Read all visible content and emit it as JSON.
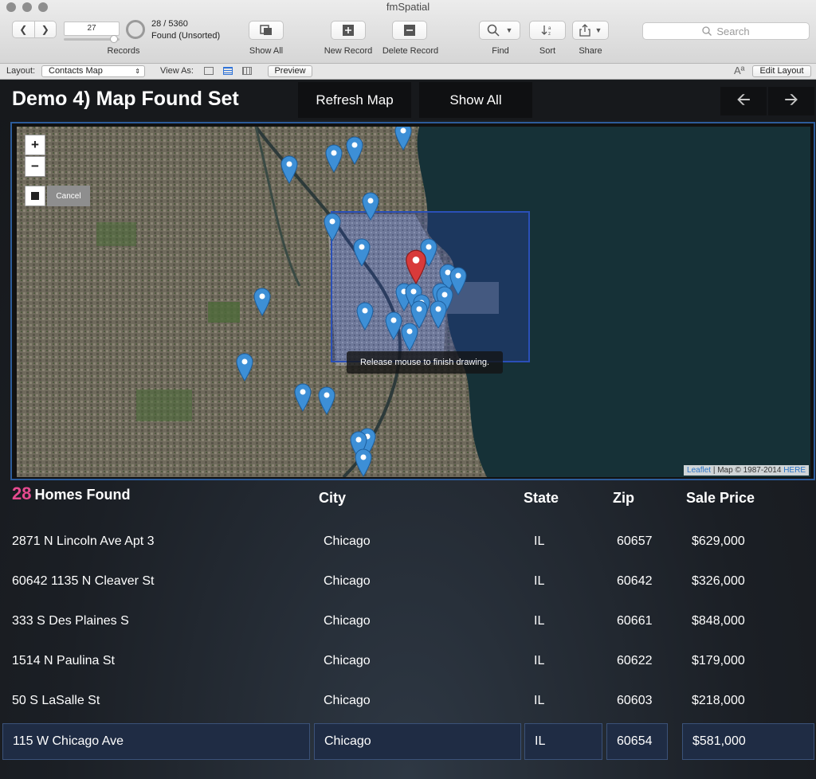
{
  "window": {
    "title": "fmSpatial"
  },
  "toolbar": {
    "record_number": "27",
    "records_label": "Records",
    "found_count": "28 / 5360",
    "found_state": "Found (Unsorted)",
    "show_all": "Show All",
    "new_record": "New Record",
    "delete_record": "Delete Record",
    "find": "Find",
    "sort": "Sort",
    "share": "Share",
    "search_placeholder": "Search"
  },
  "layout_bar": {
    "layout_label": "Layout:",
    "layout_value": "Contacts Map",
    "view_as_label": "View As:",
    "preview": "Preview",
    "edit_layout": "Edit Layout"
  },
  "header": {
    "title": "Demo 4) Map Found Set",
    "refresh_map": "Refresh Map",
    "show_all": "Show All"
  },
  "map": {
    "zoom_in": "+",
    "zoom_out": "−",
    "cancel": "Cancel",
    "tooltip": "Release mouse to finish drawing.",
    "attribution_link": "Leaflet",
    "attribution_sep": " | Map © 1987-2014 ",
    "attribution_here": "HERE"
  },
  "results": {
    "count": "28",
    "count_label": "Homes Found",
    "columns": {
      "city": "City",
      "state": "State",
      "zip": "Zip",
      "price": "Sale Price"
    },
    "rows": [
      {
        "address": "2871 N Lincoln Ave Apt 3",
        "city": "Chicago",
        "state": "IL",
        "zip": "60657",
        "price": "$629,000"
      },
      {
        "address": "60642 1135 N Cleaver St",
        "city": "Chicago",
        "state": "IL",
        "zip": "60642",
        "price": "$326,000"
      },
      {
        "address": "333 S Des Plaines S",
        "city": "Chicago",
        "state": "IL",
        "zip": "60661",
        "price": "$848,000"
      },
      {
        "address": "1514 N Paulina St",
        "city": "Chicago",
        "state": "IL",
        "zip": "60622",
        "price": "$179,000"
      },
      {
        "address": "50 S LaSalle St",
        "city": "Chicago",
        "state": "IL",
        "zip": "60603",
        "price": "$218,000"
      },
      {
        "address": "115 W Chicago Ave",
        "city": "Chicago",
        "state": "IL",
        "zip": "60654",
        "price": "$581,000"
      }
    ]
  }
}
